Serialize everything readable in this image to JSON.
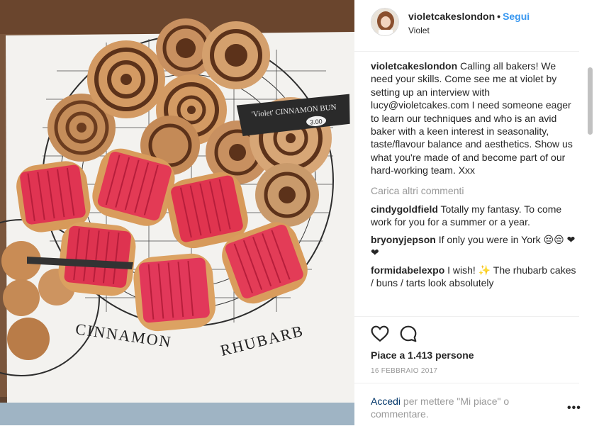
{
  "post": {
    "photo_text": {
      "sign_label": "'Violet' CINNAMON BUN",
      "price": "3.00",
      "left_label": "CINNAMON",
      "right_label": "RHUBARB"
    }
  },
  "header": {
    "username": "violetcakeslondon",
    "separator": "•",
    "follow_label": "Segui",
    "subtitle": "Violet"
  },
  "caption": {
    "username": "violetcakeslondon",
    "text": "Calling all bakers! We need your skills. Come see me at violet by setting up an interview with lucy@violetcakes.com I need someone eager to learn our techniques and who is an avid baker with a keen interest in seasonality, taste/flavour balance and aesthetics. Show us what you're made of and become part of our hard-working team. Xxx"
  },
  "load_more_label": "Carica altri commenti",
  "comments": [
    {
      "username": "cindygoldfield",
      "text": "Totally my fantasy. To come work for you for a summer or a year."
    },
    {
      "username": "bryonyjepson",
      "text": "If only you were in York 😔😔 ❤❤"
    },
    {
      "username": "formidabelexpo",
      "text": "I wish! ✨ The rhubarb cakes / buns / tarts look absolutely"
    }
  ],
  "actions": {
    "like_icon": "heart-outline-icon",
    "comment_icon": "speech-bubble-icon",
    "likes_text": "Piace a 1.413 persone",
    "date": "16 FEBBRAIO 2017"
  },
  "login": {
    "link": "Accedi",
    "rest": " per mettere \"Mi piace\" o commentare.",
    "more_icon": "•••"
  },
  "colors": {
    "link_blue": "#3897f0",
    "login_blue": "#003569",
    "muted": "#999999",
    "text": "#262626"
  }
}
